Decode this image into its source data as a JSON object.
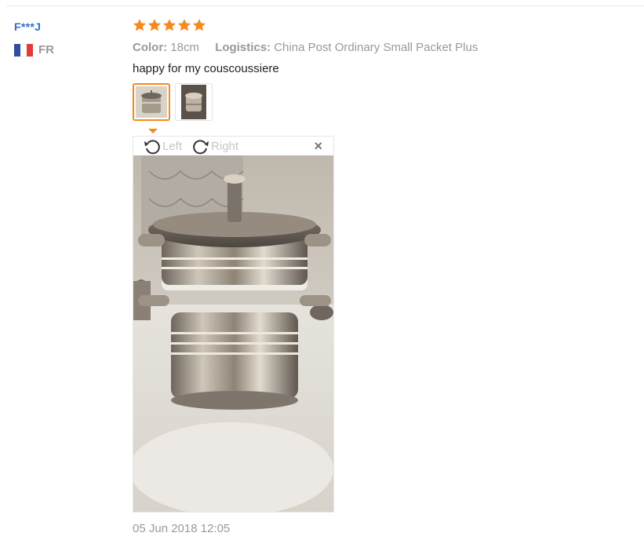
{
  "review": {
    "user_name": "F***J",
    "country_code": "FR",
    "flag_colors": [
      "#2f4ea0",
      "#ffffff",
      "#e23a3a"
    ],
    "rating": 5,
    "rating_color": "#f5891f",
    "color_key": "Color:",
    "color_value": "18cm",
    "logistics_key": "Logistics:",
    "logistics_value": "China Post Ordinary Small Packet Plus",
    "text": "happy for my couscoussiere",
    "date": "05 Jun 2018 12:05"
  },
  "viewer": {
    "rotate_left_label": "Left",
    "rotate_right_label": "Right",
    "close_label": "×"
  },
  "thumbnails": [
    {
      "name": "photo-thumbnail-1",
      "active": true
    },
    {
      "name": "photo-thumbnail-2",
      "active": false
    }
  ]
}
